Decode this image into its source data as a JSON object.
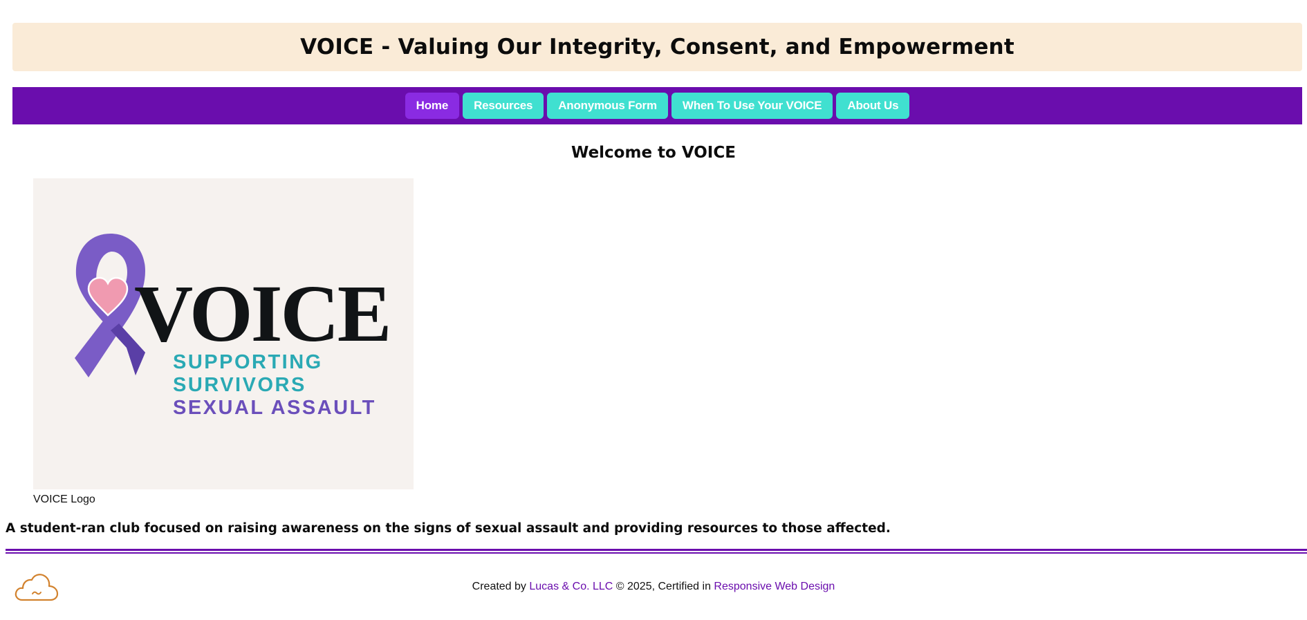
{
  "header": {
    "title": "VOICE - Valuing Our Integrity, Consent, and Empowerment"
  },
  "nav": {
    "items": [
      {
        "label": "Home",
        "active": true
      },
      {
        "label": "Resources",
        "active": false
      },
      {
        "label": "Anonymous Form",
        "active": false
      },
      {
        "label": "When To Use Your VOICE",
        "active": false
      },
      {
        "label": "About Us",
        "active": false
      }
    ]
  },
  "main": {
    "welcome": "Welcome to VOICE",
    "logo": {
      "word": "VOICE",
      "line1": "SUPPORTING",
      "line2": "SURVIVORS",
      "line3": "SEXUAL ASSAULT",
      "caption": "VOICE Logo"
    },
    "tagline": "A student-ran club focused on raising awareness on the signs of sexual assault and providing resources to those affected."
  },
  "footer": {
    "prefix": "Created by ",
    "company": "Lucas & Co. LLC",
    "middle": " © 2025, Certified in ",
    "cert": "Responsive Web Design",
    "icon": "cloud-icon"
  },
  "colors": {
    "header_bg": "#faebd7",
    "nav_bg": "#6a0dad",
    "nav_button": "#40e0d0",
    "nav_button_active": "#8a2be2",
    "link": "#6a0dad",
    "logo_teal": "#2aa9b4",
    "logo_purple": "#6b4fbb",
    "cloud": "#d2822e"
  }
}
